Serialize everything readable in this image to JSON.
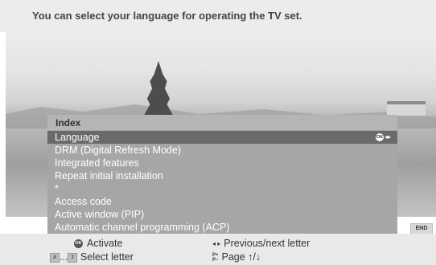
{
  "header": {
    "text": "You can select your language for operating the TV set."
  },
  "panel": {
    "title": "Index",
    "items": [
      {
        "label": "Language",
        "selected": true
      },
      {
        "label": "DRM (Digital Refresh Mode)"
      },
      {
        "label": "Integrated features"
      },
      {
        "label": "Repeat initial installation"
      },
      {
        "label": "*"
      },
      {
        "label": "Access code"
      },
      {
        "label": "Active window (PIP)"
      },
      {
        "label": "Automatic channel programming (ACP)"
      }
    ],
    "selected_hint": {
      "ok": "OK",
      "arrows": "◂▸"
    }
  },
  "end_button": "END",
  "legend": {
    "ok_icon": "OK",
    "activate": "Activate",
    "key_a": "a",
    "ellipsis": "...",
    "key_z": "z",
    "select_letter": "Select letter",
    "lr_arrows": "◂ ▸",
    "prev_next": "Previous/next letter",
    "p_plus": "P+",
    "p_minus": "P−",
    "page": "Page ↑/↓"
  },
  "colors": {
    "panel_bg": "#a6a6a6",
    "selected_row": "#6a6a6a",
    "header_bg": "#ececec"
  },
  "icons": [
    "ok-icon",
    "left-right-arrows-icon",
    "page-up-down-icon",
    "letter-key-icon"
  ]
}
